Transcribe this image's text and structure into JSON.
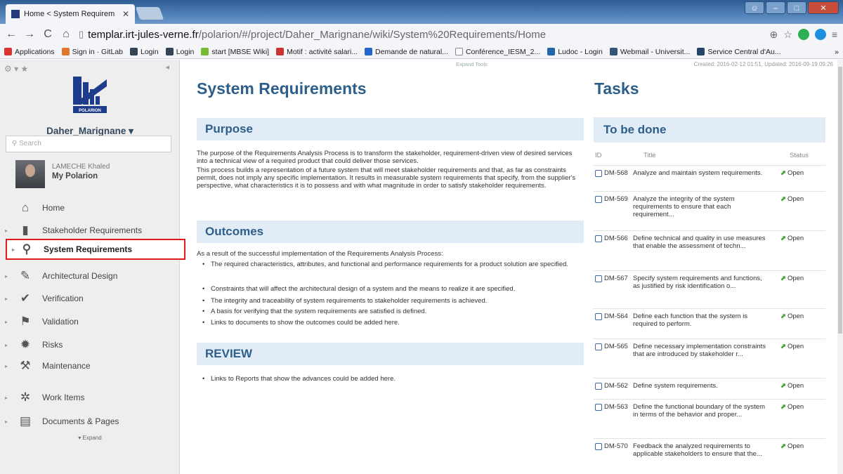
{
  "browser": {
    "tab_title": "Home < System Requirem",
    "tab_close": "✕",
    "url_domain": "templar.irt-jules-verne.fr",
    "url_path": "/polarion/#/project/Daher_Marignane/wiki/System%20Requirements/Home",
    "bookmarks": [
      "Applications",
      "Sign in · GitLab",
      "Login",
      "Login",
      "start [MBSE Wiki]",
      "Motif : activité salari...",
      "Demande de natural...",
      "Conférence_IESM_2...",
      "Ludoc - Login",
      "Webmail - Universit...",
      "Service Central d'Au..."
    ],
    "more": "»"
  },
  "sidebar": {
    "logo_text": "POLARION",
    "project": "Daher_Marignane ▾",
    "search_placeholder": "Search",
    "user_name": "LAMECHE Khaled",
    "user_link": "My Polarion",
    "items": [
      {
        "label": "Home",
        "icon": "⌂"
      },
      {
        "label": "Stakeholder Requirements",
        "icon": "▮"
      },
      {
        "label": "System Requirements",
        "icon": "⚲"
      },
      {
        "label": "Architectural Design",
        "icon": "✎"
      },
      {
        "label": "Verification",
        "icon": "✔"
      },
      {
        "label": "Validation",
        "icon": "⚑"
      },
      {
        "label": "Risks",
        "icon": "✹"
      },
      {
        "label": "Maintenance",
        "icon": "⚒"
      },
      {
        "label": "Work Items",
        "icon": "✲"
      },
      {
        "label": "Documents & Pages",
        "icon": "▤"
      }
    ],
    "expand": "▾ Expand"
  },
  "main": {
    "expand_tools": "Expand Tools",
    "title": "System Requirements",
    "purpose_heading": "Purpose",
    "purpose_p1": "The purpose of the Requirements Analysis Process is to transform the stakeholder, requirement-driven view of desired services into a technical view of a required product that could deliver those services.",
    "purpose_p2": "This process builds a representation of a future system that will meet stakeholder requirements and that, as far as constraints permit, does not imply any specific implementation. It results in measurable system requirements that specify, from the supplier's perspective, what characteristics it is to possess and with what magnitude in order to satisfy stakeholder requirements.",
    "outcomes_heading": "Outcomes",
    "outcomes_intro": "As a result of the successful implementation of the Requirements Analysis Process:",
    "outcomes": [
      "The required characteristics, attributes, and functional and performance requirements for a product solution are specified.",
      "Constraints that will affect the architectural design of a system and the means to realize it are specified.",
      "The integrity and traceability of system requirements to stakeholder requirements is achieved.",
      "A basis for verifying that the system requirements are satisfied is defined.",
      "Links to documents to show the outcomes could be added here."
    ],
    "review_heading": "REVIEW",
    "review_items": [
      "Links to Reports that show the advances could be added here."
    ]
  },
  "tasks": {
    "meta": "Created: 2016-02-12 01:51, Updated: 2016-09-19 09:26",
    "title": "Tasks",
    "subtitle": "To be done",
    "col_id": "ID",
    "col_title": "Title",
    "col_status": "Status",
    "rows": [
      {
        "id": "DM-568",
        "title": "Analyze and maintain system requirements.",
        "status": "Open"
      },
      {
        "id": "DM-569",
        "title": "Analyze the integrity of the system requirements to ensure that each requirement...",
        "status": "Open"
      },
      {
        "id": "DM-566",
        "title": "Define technical and quality in use measures that enable the assessment of techn...",
        "status": "Open"
      },
      {
        "id": "DM-567",
        "title": "Specify system requirements and functions, as justified by risk identification o...",
        "status": "Open"
      },
      {
        "id": "DM-564",
        "title": "Define each function that the system is required to perform.",
        "status": "Open"
      },
      {
        "id": "DM-565",
        "title": "Define necessary implementation constraints that are introduced by stakeholder r...",
        "status": "Open"
      },
      {
        "id": "DM-562",
        "title": "Define system requirements.",
        "status": "Open"
      },
      {
        "id": "DM-563",
        "title": "Define the functional boundary of the system in terms of the behavior and proper...",
        "status": "Open"
      },
      {
        "id": "DM-570",
        "title": "Feedback the analyzed requirements to applicable stakeholders to ensure that the...",
        "status": "Open"
      }
    ]
  }
}
